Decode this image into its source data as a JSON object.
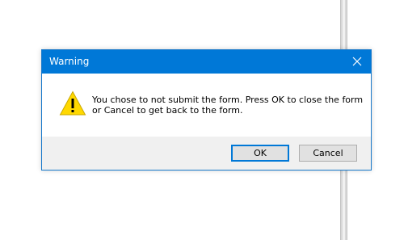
{
  "dialog": {
    "title": "Warning",
    "icon": "warning-triangle-icon",
    "message_lines": [
      "You chose to not submit the form. Press OK to close the form",
      "or Cancel to get back to the form."
    ],
    "buttons": {
      "ok_label": "OK",
      "cancel_label": "Cancel"
    },
    "colors": {
      "titlebar": "#0078d7",
      "warning_fill": "#ffd800"
    }
  }
}
